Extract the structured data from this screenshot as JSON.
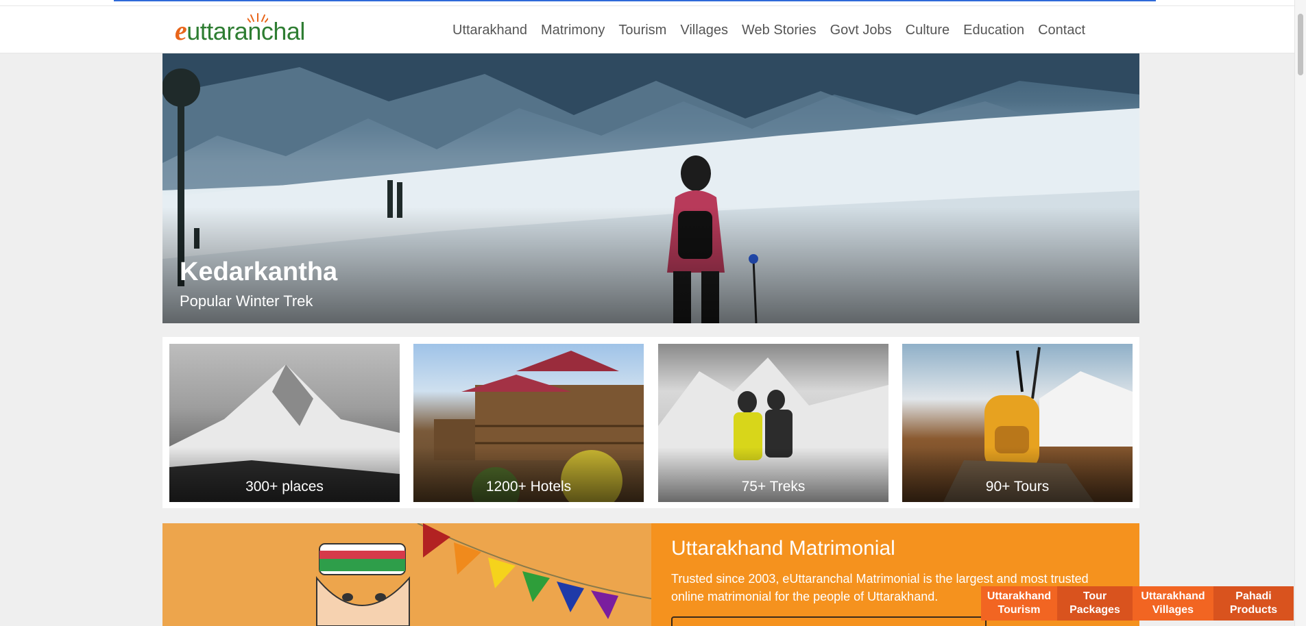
{
  "site": {
    "logo_e": "e",
    "logo_rest": "uttaranchal"
  },
  "nav": [
    "Uttarakhand",
    "Matrimony",
    "Tourism",
    "Villages",
    "Web Stories",
    "Govt Jobs",
    "Culture",
    "Education",
    "Contact"
  ],
  "hero": {
    "title": "Kedarkantha",
    "subtitle": "Popular Winter Trek"
  },
  "stats": [
    {
      "label": "300+ places"
    },
    {
      "label": "1200+ Hotels"
    },
    {
      "label": "75+ Treks"
    },
    {
      "label": "90+ Tours"
    }
  ],
  "matrimonial": {
    "title": "Uttarakhand Matrimonial",
    "description": "Trusted since 2003, eUttaranchal Matrimonial is the largest and most trusted online matrimonial for the people of Uttarakhand."
  },
  "floating_links": [
    {
      "label_line1": "Uttarakhand",
      "label_line2": "Tourism",
      "color": "#f26522"
    },
    {
      "label_line1": "Tour",
      "label_line2": "Packages",
      "color": "#d9531e"
    },
    {
      "label_line1": "Uttarakhand",
      "label_line2": "Villages",
      "color": "#f26522"
    },
    {
      "label_line1": "Pahadi",
      "label_line2": "Products",
      "color": "#d9531e"
    }
  ],
  "colors": {
    "brand_orange": "#e8651a",
    "brand_green": "#2e7d32",
    "matri_orange": "#f5921e"
  }
}
